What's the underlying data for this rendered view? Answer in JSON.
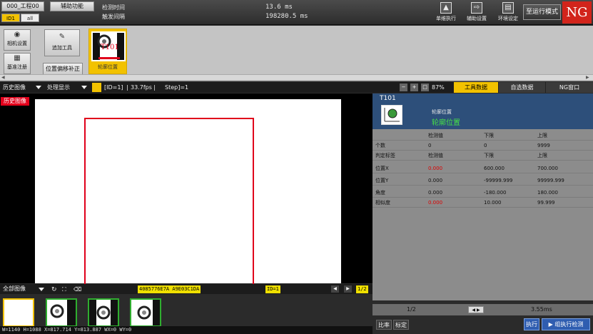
{
  "header": {
    "project": "000_工程00",
    "function_menu": "辅助功能",
    "tab_a": "ID1",
    "tab_b": "all",
    "detect_time_label": "检测时间",
    "trigger_interval_label": "触发间隔",
    "detect_time_value": "13.6 ms",
    "trigger_interval_value": "198280.5 ms",
    "tools": [
      {
        "label": "单维执行",
        "icon": "single-run-icon"
      },
      {
        "label": "辅助设置",
        "icon": "aux-settings-icon"
      },
      {
        "label": "环境设定",
        "icon": "environment-icon"
      }
    ],
    "run_mode": "至运行模式",
    "result": "NG",
    "result_color": "#d2241b"
  },
  "toolbar": {
    "camera_settings": "相机设置",
    "calibration": "基准注册",
    "add_tool": "追加工具",
    "position_correction": "位置偏移补正",
    "tool_card_id": "T101",
    "tool_card_label": "轮廓位置",
    "accent": "#f2c200"
  },
  "image_bar": {
    "history": "历史图像",
    "processing": "处理显示",
    "id_info": "[ID=1]",
    "fps": "33.7fps",
    "step": "Step]=1",
    "history_badge": "历史图像"
  },
  "image_sub": {
    "all_images": "全部图像",
    "hash": "4085776E7A A9E03C1DA",
    "id": "ID=1",
    "page": "1/2"
  },
  "status": "W=1140 H=1088  X=817.714 Y=813.887 WX=0 WY=0",
  "right_panel": {
    "zoom": "87%",
    "tabs": [
      "工具数据",
      "自选数据",
      "NG窗口"
    ],
    "tool_id": "T101",
    "tool_type": "轮廓位置",
    "tool_name": "轮廓位置",
    "col_headers": [
      "检测值",
      "下限",
      "上限"
    ],
    "rows": [
      {
        "name": "个数",
        "value": "0",
        "low": "0",
        "high": "9999",
        "ng": false
      },
      {
        "name": "判定标签",
        "value": "检测值",
        "low": "下限",
        "high": "上限",
        "ng": false
      },
      {
        "name": "位置X",
        "value": "0.000",
        "low": "600.000",
        "high": "700.000",
        "ng": true
      },
      {
        "name": "位置Y",
        "value": "0.000",
        "low": "-99999.999",
        "high": "99999.999",
        "ng": false
      },
      {
        "name": "角度",
        "value": "0.000",
        "low": "-180.000",
        "high": "180.000",
        "ng": false
      },
      {
        "name": "相似度",
        "value": "0.000",
        "low": "10.000",
        "high": "99.999",
        "ng": true
      }
    ],
    "pager": "1/2",
    "time": "3.55ms",
    "compare": "比率",
    "label": "标定",
    "execute": "执行",
    "execute_all": "组执行检测"
  }
}
